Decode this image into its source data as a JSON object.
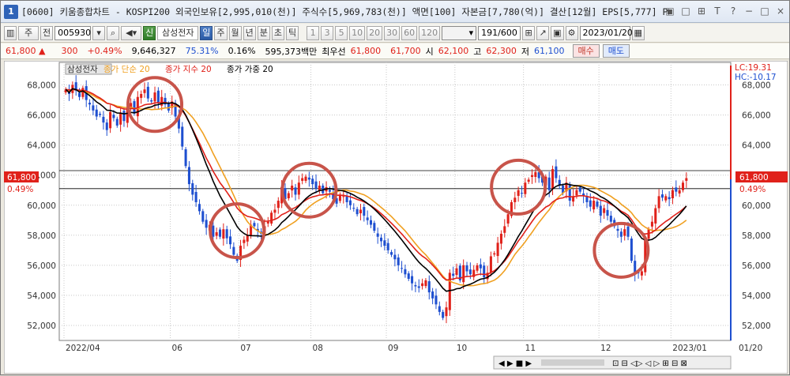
{
  "window": {
    "number": "1",
    "title": "[0600] 키움종합차트 - KOSPI200 외국인보유[2,995,010(천)] 주식수[5,969,783(천)] 액면[100] 자본금[7,780(억)] 결산[12월] EPS[5,777] PER[",
    "buttons": [
      "▣",
      "□",
      "⊞",
      "T",
      "?",
      "−",
      "□",
      "×"
    ]
  },
  "toolbar": {
    "period_select": "주",
    "prev_label": "전",
    "code": "005930",
    "search_icon": "magnifier-icon",
    "name_badge": "신",
    "stock_name": "삼성전자",
    "periods": [
      "일",
      "주",
      "월",
      "년",
      "분",
      "초",
      "틱"
    ],
    "active_period": "일",
    "intervals": [
      "1",
      "3",
      "5",
      "10",
      "20",
      "30",
      "60",
      "120"
    ],
    "count": "191",
    "count_total": "/600",
    "date": "2023/01/20"
  },
  "quote": {
    "price": "61,800",
    "arrow": "▲",
    "change": "300",
    "change_pct": "+0.49%",
    "volume": "9,646,327",
    "vol_ratio": "75.31%",
    "turnover": "0.16%",
    "amount": "595,373백만",
    "pref_label": "최우선",
    "ask": "61,800",
    "bid": "61,700",
    "open_label": "시",
    "open": "62,100",
    "high_label": "고",
    "high": "62,300",
    "low_label": "저",
    "low": "61,100",
    "buy_label": "매수",
    "sell_label": "매도"
  },
  "chart_data": {
    "type": "candlestick",
    "title": "",
    "legend": [
      {
        "name": "삼성전자",
        "color": "#333333"
      },
      {
        "name": "종가 단순 20",
        "color": "#f0a020"
      },
      {
        "name": "종가 지수 20",
        "color": "#e0211a"
      },
      {
        "name": "종가 가중 20",
        "color": "#000000"
      }
    ],
    "ylim": [
      51000,
      69500
    ],
    "y_ticks": [
      52000,
      54000,
      56000,
      58000,
      60000,
      62000,
      64000,
      66000,
      68000
    ],
    "y_tick_labels": [
      "52,000",
      "54,000",
      "56,000",
      "58,000",
      "60,000",
      "62,000",
      "64,000",
      "66,000",
      "68,000"
    ],
    "x_ticks": [
      {
        "label": "2022/04",
        "idx": 0
      },
      {
        "label": "06",
        "idx": 31
      },
      {
        "label": "07",
        "idx": 51
      },
      {
        "label": "08",
        "idx": 72
      },
      {
        "label": "09",
        "idx": 94
      },
      {
        "label": "10",
        "idx": 114
      },
      {
        "label": "11",
        "idx": 134
      },
      {
        "label": "12",
        "idx": 156
      },
      {
        "label": "2023/01",
        "idx": 177
      }
    ],
    "x_end_label": "01/20",
    "hlines": [
      62300,
      61100
    ],
    "current_price_label": "61,800",
    "current_pct_label": "0.49%",
    "lc_label": "LC:19.31",
    "hc_label": "HC:-10.17",
    "closes": [
      67700,
      67400,
      68000,
      67600,
      67200,
      67800,
      67000,
      66700,
      66300,
      65900,
      66000,
      65500,
      65000,
      66200,
      65800,
      65300,
      66100,
      65600,
      66500,
      66800,
      66100,
      67200,
      67400,
      67700,
      67100,
      66900,
      67500,
      66800,
      67200,
      66700,
      66300,
      66900,
      65900,
      65100,
      63900,
      62600,
      61400,
      60700,
      60200,
      59600,
      58900,
      58500,
      58700,
      57900,
      58200,
      57900,
      58400,
      57800,
      57400,
      56700,
      56300,
      57300,
      57700,
      58000,
      58700,
      58600,
      58300,
      58100,
      58600,
      58900,
      59500,
      59700,
      60300,
      61200,
      60400,
      60800,
      61300,
      60700,
      61500,
      61800,
      61900,
      61700,
      61400,
      61100,
      61300,
      60800,
      61200,
      60900,
      60400,
      60100,
      60700,
      60600,
      60200,
      60000,
      59800,
      59400,
      59700,
      59300,
      59000,
      58700,
      58300,
      57900,
      57600,
      57300,
      57000,
      56700,
      56400,
      56000,
      55800,
      55400,
      55100,
      54800,
      54600,
      54500,
      54800,
      55000,
      54200,
      53800,
      53400,
      52900,
      52500,
      53200,
      55500,
      55300,
      55800,
      55000,
      56000,
      55600,
      55400,
      55700,
      56000,
      55800,
      55200,
      55500,
      56600,
      56800,
      57500,
      58100,
      58600,
      59400,
      60200,
      60500,
      61000,
      60800,
      61500,
      61700,
      62000,
      62200,
      61800,
      61500,
      61900,
      61000,
      62400,
      61800,
      61300,
      60800,
      61500,
      60300,
      60600,
      61000,
      60900,
      60600,
      60200,
      59900,
      60300,
      59900,
      59300,
      59800,
      59300,
      58900,
      58600,
      58300,
      57900,
      58400,
      57900,
      56300,
      55400,
      55500,
      55600,
      57700,
      58400,
      58900,
      59800,
      60600,
      60500,
      60600,
      60400,
      61000,
      60900,
      61000,
      61500,
      61800
    ]
  }
}
